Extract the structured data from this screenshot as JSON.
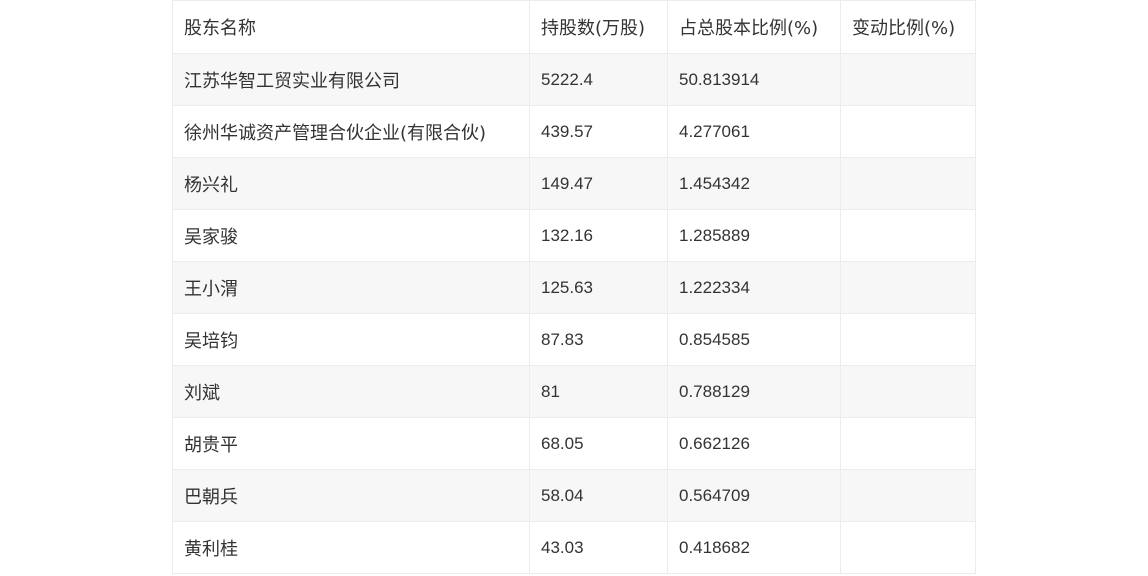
{
  "table": {
    "headers": [
      "股东名称",
      "持股数(万股)",
      "占总股本比例(%)",
      "变动比例(%)"
    ],
    "rows": [
      [
        "江苏华智工贸实业有限公司",
        "5222.4",
        "50.813914",
        ""
      ],
      [
        "徐州华诚资产管理合伙企业(有限合伙)",
        "439.57",
        "4.277061",
        ""
      ],
      [
        "杨兴礼",
        "149.47",
        "1.454342",
        ""
      ],
      [
        "吴家骏",
        "132.16",
        "1.285889",
        ""
      ],
      [
        "王小渭",
        "125.63",
        "1.222334",
        ""
      ],
      [
        "吴培钧",
        "87.83",
        "0.854585",
        ""
      ],
      [
        "刘斌",
        "81",
        "0.788129",
        ""
      ],
      [
        "胡贵平",
        "68.05",
        "0.662126",
        ""
      ],
      [
        "巴朝兵",
        "58.04",
        "0.564709",
        ""
      ],
      [
        "黄利桂",
        "43.03",
        "0.418682",
        ""
      ]
    ]
  }
}
